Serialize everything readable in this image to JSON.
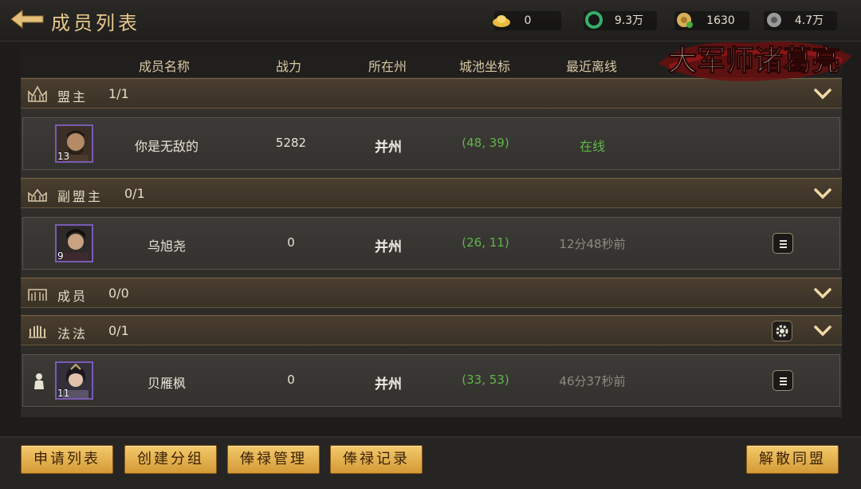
{
  "title": "成员列表",
  "resources": [
    {
      "icon": "gold-ingot-icon",
      "value": "0"
    },
    {
      "icon": "jade-coin-icon",
      "value": "9.3万"
    },
    {
      "icon": "copper-coin-icon",
      "value": "1630"
    },
    {
      "icon": "silver-coin-icon",
      "value": "4.7万"
    }
  ],
  "logo_text": "大军师诸葛亮",
  "columns": {
    "name": "成员名称",
    "power": "战力",
    "state": "所在州",
    "coord": "城池坐标",
    "last_offline": "最近离线"
  },
  "groups": [
    {
      "name": "盟主",
      "count": "1/1"
    },
    {
      "name": "副盟主",
      "count": "0/1"
    },
    {
      "name": "成员",
      "count": "0/0"
    },
    {
      "name": "法法",
      "count": "0/1"
    }
  ],
  "members": [
    {
      "level": "13",
      "name": "你是无敌的",
      "power": "5282",
      "state": "并州",
      "coord": "(48, 39)",
      "last_offline": "在线"
    },
    {
      "level": "9",
      "name": "乌旭尧",
      "power": "0",
      "state": "并州",
      "coord": "(26, 11)",
      "last_offline": "12分48秒前"
    },
    {
      "level": "11",
      "name": "贝雁枫",
      "power": "0",
      "state": "并州",
      "coord": "(33, 53)",
      "last_offline": "46分37秒前"
    }
  ],
  "buttons": {
    "apply_list": "申请列表",
    "create_group": "创建分组",
    "salary_manage": "俸禄管理",
    "salary_record": "俸禄记录",
    "disband": "解散同盟"
  },
  "colors": {
    "accent_gold": "#e8c98a",
    "online_green": "#5fb548",
    "button_gold": "#f3c96b"
  }
}
